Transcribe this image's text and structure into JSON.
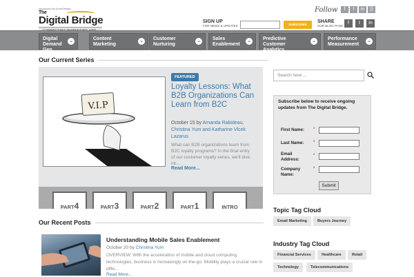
{
  "header": {
    "logo_small": "sponsored by AnonDesign",
    "logo_the": "The",
    "logo_brand": "Digital Bridge",
    "logo_tagline": "CONNECTING MARKETING AND SALES",
    "follow_label": "Follow Us",
    "signup_label": "SIGN UP",
    "signup_sub": "FOR NEWS & UPDATES",
    "subscribe_button": "SUBSCRIBE",
    "share_label": "SHARE",
    "share_sub": "OUR BLOG PAGE"
  },
  "nav": {
    "items": [
      {
        "label": "Digital Demand Gen"
      },
      {
        "label": "Content Marketing"
      },
      {
        "label": "Customer Nurturing"
      },
      {
        "label": "Sales Enablement"
      },
      {
        "label": "Predictive Customer Analytics"
      },
      {
        "label": "Performance Measurement"
      }
    ]
  },
  "series": {
    "section_title": "Our Current Series",
    "badge": "FEATURED",
    "title": "Loyalty Lessons: What B2B Organizations Can Learn from B2C",
    "date": "October 15",
    "by": "by",
    "authors": "Amanda Rabideau, Christina Yum and Katharine Vlcek Lazarus",
    "excerpt": "What can B2B organizations learn from B2C loyalty programs? In the final entry of our customer loyalty series, we'll dive int...",
    "read_more": "Read More...",
    "image_text": "V.I.P",
    "parts": [
      {
        "prefix": "PART",
        "num": "4"
      },
      {
        "prefix": "PART",
        "num": "3"
      },
      {
        "prefix": "PART",
        "num": "2"
      },
      {
        "prefix": "PART",
        "num": "1"
      },
      {
        "prefix": "INTRO",
        "num": ""
      }
    ]
  },
  "recent": {
    "section_title": "Our Recent Posts",
    "post_title": "Understanding Mobile Sales Enablement",
    "post_date": "October 20",
    "post_by": "by",
    "post_author": "Christina Yum",
    "post_excerpt": "OVERVIEW: With the acceleration of mobile and cloud computing technologies, business is increasingly on-the-go. Mobility plays a crucial role in diffe...",
    "post_more": "Read More..."
  },
  "sidebar": {
    "search_placeholder": "Search here ...",
    "form_heading": "Subscribe below to receive ongoing updates from The Digital Bridge.",
    "fields": [
      {
        "label": "First Name:"
      },
      {
        "label": "Last Name:"
      },
      {
        "label": "Email Address:"
      },
      {
        "label": "Company Name:"
      }
    ],
    "required_mark": "*",
    "submit": "Submit",
    "topic_title": "Topic Tag Cloud",
    "topic_tags": [
      "Email Marketing",
      "Buyers Journey"
    ],
    "industry_title": "Industry Tag Cloud",
    "industry_tags": [
      "Financial Services",
      "Healthcare",
      "Retail",
      "Technology",
      "Telecommunications"
    ]
  },
  "colors": {
    "accent": "#3d7aa8",
    "nav_bg": "#8a8c8e",
    "subscribe": "#f2b11a"
  }
}
